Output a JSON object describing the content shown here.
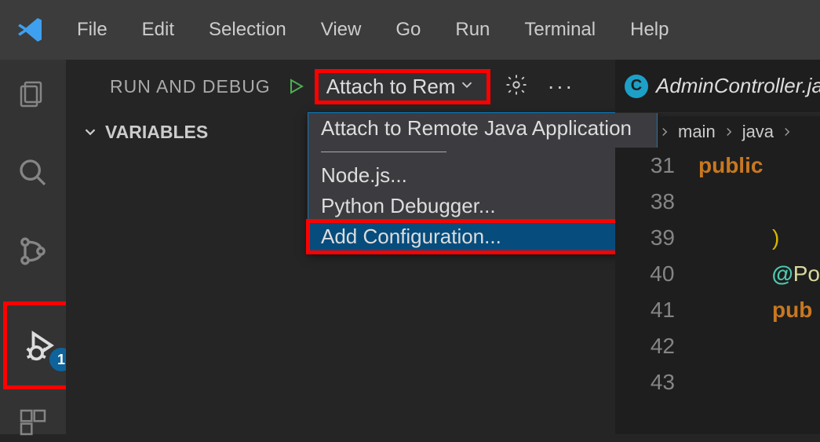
{
  "menubar": {
    "items": [
      "File",
      "Edit",
      "Selection",
      "View",
      "Go",
      "Run",
      "Terminal",
      "Help"
    ]
  },
  "activitybar": {
    "run_debug_badge": "1"
  },
  "run_panel": {
    "title": "RUN AND DEBUG",
    "config_selected": "Attach to Rem",
    "variables_label": "VARIABLES"
  },
  "dropdown": {
    "options": [
      "Attach to Remote Java Application",
      "Node.js...",
      "Python Debugger...",
      "Add Configuration..."
    ],
    "selected_index": 3
  },
  "editor": {
    "tab_label": "AdminController.ja",
    "tab_icon_letter": "C",
    "breadcrumb": {
      "seg1": "main",
      "seg2": "java"
    },
    "lines": [
      {
        "num": "31",
        "html_class": "kw-public",
        "text": "public"
      },
      {
        "num": "38",
        "html_class": "",
        "text": ""
      },
      {
        "num": "39",
        "text": ")",
        "html_class": "brace"
      },
      {
        "num": "40",
        "annot": true,
        "text_at": "@",
        "text_rest": "Po"
      },
      {
        "num": "41",
        "html_class": "kw-public",
        "text": "pub"
      },
      {
        "num": "42",
        "html_class": "",
        "text": ""
      },
      {
        "num": "43",
        "html_class": "",
        "text": ""
      }
    ]
  }
}
